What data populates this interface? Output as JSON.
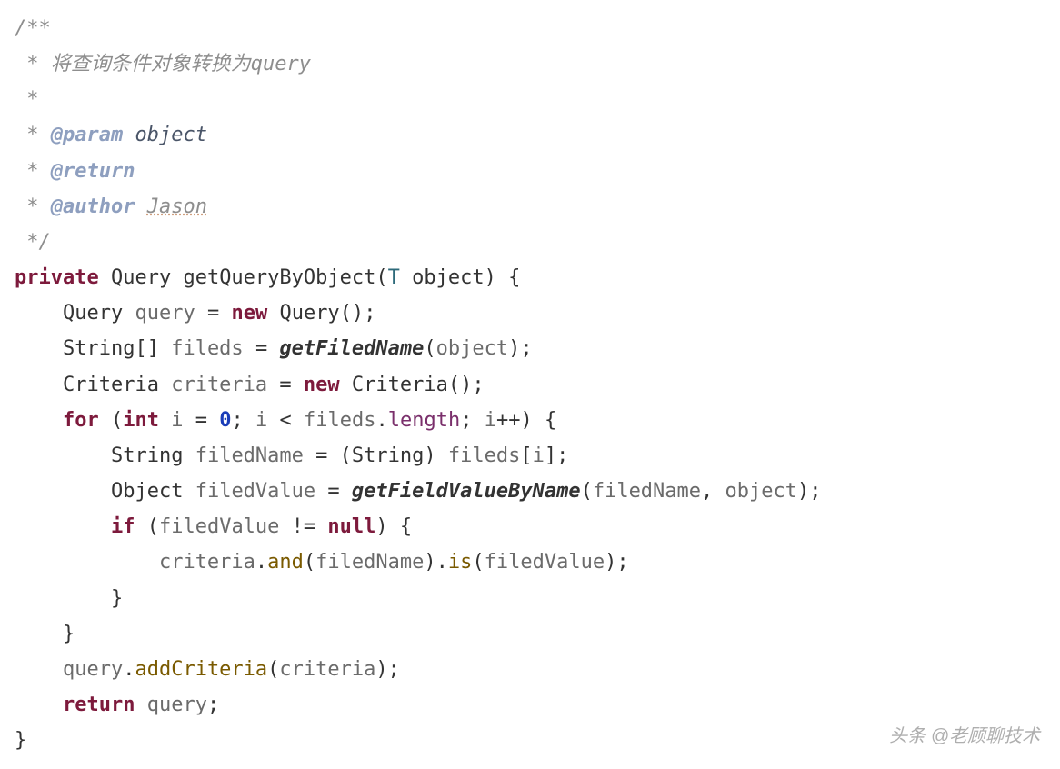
{
  "javadoc": {
    "open": "/**",
    "desc_prefix": " * ",
    "desc": "将查询条件对象转换为query",
    "blank": " *",
    "param_tag": "@param",
    "param_name": "object",
    "return_tag": "@return",
    "author_tag": "@author",
    "author_name": "Jason",
    "close": " */"
  },
  "k": {
    "private": "private",
    "new": "new",
    "for": "for",
    "int": "int",
    "if": "if",
    "null": "null",
    "return": "return"
  },
  "t": {
    "Query": "Query",
    "String": "String",
    "StringArr": "String[]",
    "Criteria": "Criteria",
    "Object": "Object",
    "T": "T"
  },
  "m": {
    "getQueryByObject": "getQueryByObject",
    "getFiledName": "getFiledName",
    "getFieldValueByName": "getFieldValueByName",
    "and": "and",
    "is": "is",
    "addCriteria": "addCriteria"
  },
  "v": {
    "object": "object",
    "query": "query",
    "fileds": "fileds",
    "criteria": "criteria",
    "i": "i",
    "filedName": "filedName",
    "filedValue": "filedValue",
    "length": "length"
  },
  "num": {
    "zero": "0"
  },
  "p": {
    "open_brace": "{",
    "close_brace": "}",
    "open_paren": "(",
    "close_paren": ")",
    "open_bracket": "[",
    "close_bracket": "]",
    "semi": ";",
    "comma": ",",
    "eq": "=",
    "lt": "<",
    "neq": "!=",
    "inc": "++",
    "dot": ".",
    "paren_pair": "()",
    "space": " "
  },
  "watermark": "头条 @老顾聊技术"
}
